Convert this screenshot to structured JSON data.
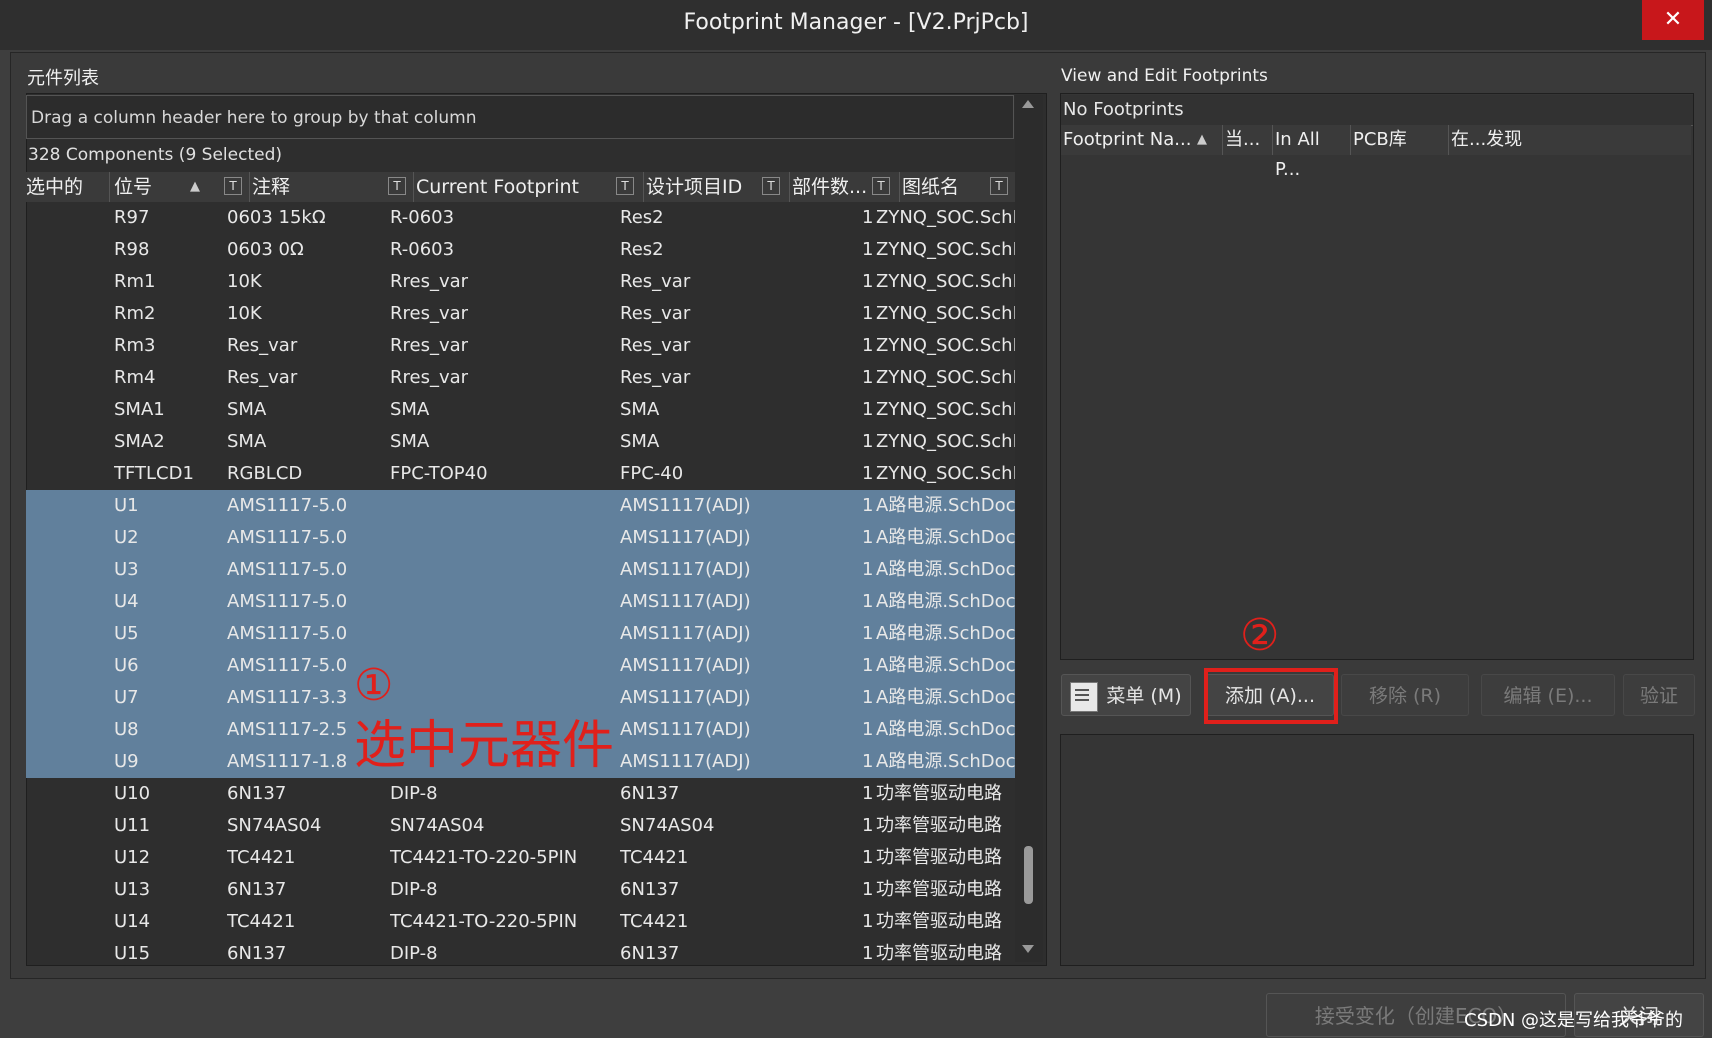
{
  "window": {
    "title": "Footprint Manager - [V2.PrjPcb]",
    "close_glyph": "✕"
  },
  "left": {
    "heading": "元件列表",
    "group_hint": "Drag a column header here to group by that column",
    "count": "328 Components (9 Selected)",
    "columns": [
      "选中的",
      "位号",
      "注释",
      "Current Footprint",
      "设计项目ID",
      "部件数...",
      "图纸名"
    ],
    "rows": [
      {
        "des": "R97",
        "comment": "0603 15kΩ",
        "fp": "R-0603",
        "id": "Res2",
        "parts": "1",
        "sheet": "ZYNQ_SOC.SchD",
        "sel": false
      },
      {
        "des": "R98",
        "comment": "0603 0Ω",
        "fp": "R-0603",
        "id": "Res2",
        "parts": "1",
        "sheet": "ZYNQ_SOC.SchD",
        "sel": false
      },
      {
        "des": "Rm1",
        "comment": "10K",
        "fp": "Rres_var",
        "id": "Res_var",
        "parts": "1",
        "sheet": "ZYNQ_SOC.SchD",
        "sel": false
      },
      {
        "des": "Rm2",
        "comment": "10K",
        "fp": "Rres_var",
        "id": "Res_var",
        "parts": "1",
        "sheet": "ZYNQ_SOC.SchD",
        "sel": false
      },
      {
        "des": "Rm3",
        "comment": "Res_var",
        "fp": "Rres_var",
        "id": "Res_var",
        "parts": "1",
        "sheet": "ZYNQ_SOC.SchD",
        "sel": false
      },
      {
        "des": "Rm4",
        "comment": "Res_var",
        "fp": "Rres_var",
        "id": "Res_var",
        "parts": "1",
        "sheet": "ZYNQ_SOC.SchD",
        "sel": false
      },
      {
        "des": "SMA1",
        "comment": "SMA",
        "fp": "SMA",
        "id": "SMA",
        "parts": "1",
        "sheet": "ZYNQ_SOC.SchD",
        "sel": false
      },
      {
        "des": "SMA2",
        "comment": "SMA",
        "fp": "SMA",
        "id": "SMA",
        "parts": "1",
        "sheet": "ZYNQ_SOC.SchD",
        "sel": false
      },
      {
        "des": "TFTLCD1",
        "comment": "RGBLCD",
        "fp": "FPC-TOP40",
        "id": "FPC-40",
        "parts": "1",
        "sheet": "ZYNQ_SOC.SchD",
        "sel": false
      },
      {
        "des": "U1",
        "comment": "AMS1117-5.0",
        "fp": "",
        "id": "AMS1117(ADJ)",
        "parts": "1",
        "sheet": "A路电源.SchDoc",
        "sel": true
      },
      {
        "des": "U2",
        "comment": "AMS1117-5.0",
        "fp": "",
        "id": "AMS1117(ADJ)",
        "parts": "1",
        "sheet": "A路电源.SchDoc",
        "sel": true
      },
      {
        "des": "U3",
        "comment": "AMS1117-5.0",
        "fp": "",
        "id": "AMS1117(ADJ)",
        "parts": "1",
        "sheet": "A路电源.SchDoc",
        "sel": true
      },
      {
        "des": "U4",
        "comment": "AMS1117-5.0",
        "fp": "",
        "id": "AMS1117(ADJ)",
        "parts": "1",
        "sheet": "A路电源.SchDoc",
        "sel": true
      },
      {
        "des": "U5",
        "comment": "AMS1117-5.0",
        "fp": "",
        "id": "AMS1117(ADJ)",
        "parts": "1",
        "sheet": "A路电源.SchDoc",
        "sel": true
      },
      {
        "des": "U6",
        "comment": "AMS1117-5.0",
        "fp": "",
        "id": "AMS1117(ADJ)",
        "parts": "1",
        "sheet": "A路电源.SchDoc",
        "sel": true
      },
      {
        "des": "U7",
        "comment": "AMS1117-3.3",
        "fp": "",
        "id": "AMS1117(ADJ)",
        "parts": "1",
        "sheet": "A路电源.SchDoc",
        "sel": true
      },
      {
        "des": "U8",
        "comment": "AMS1117-2.5",
        "fp": "",
        "id": "AMS1117(ADJ)",
        "parts": "1",
        "sheet": "A路电源.SchDoc",
        "sel": true
      },
      {
        "des": "U9",
        "comment": "AMS1117-1.8",
        "fp": "",
        "id": "AMS1117(ADJ)",
        "parts": "1",
        "sheet": "A路电源.SchDoc",
        "sel": true
      },
      {
        "des": "U10",
        "comment": "6N137",
        "fp": "DIP-8",
        "id": "6N137",
        "parts": "1",
        "sheet": "功率管驱动电路",
        "sel": false
      },
      {
        "des": "U11",
        "comment": "SN74AS04",
        "fp": "SN74AS04",
        "id": "SN74AS04",
        "parts": "1",
        "sheet": "功率管驱动电路",
        "sel": false
      },
      {
        "des": "U12",
        "comment": "TC4421",
        "fp": "TC4421-TO-220-5PIN",
        "id": "TC4421",
        "parts": "1",
        "sheet": "功率管驱动电路",
        "sel": false
      },
      {
        "des": "U13",
        "comment": "6N137",
        "fp": "DIP-8",
        "id": "6N137",
        "parts": "1",
        "sheet": "功率管驱动电路",
        "sel": false
      },
      {
        "des": "U14",
        "comment": "TC4421",
        "fp": "TC4421-TO-220-5PIN",
        "id": "TC4421",
        "parts": "1",
        "sheet": "功率管驱动电路",
        "sel": false
      },
      {
        "des": "U15",
        "comment": "6N137",
        "fp": "DIP-8",
        "id": "6N137",
        "parts": "1",
        "sheet": "功率管驱动电路",
        "sel": false
      }
    ],
    "selected_color": "#61809c"
  },
  "right": {
    "heading": "View and Edit Footprints",
    "no_footprints": "No Footprints",
    "columns": [
      "Footprint Na...",
      "当...",
      "In All P...",
      "PCB库",
      "在...发现"
    ],
    "buttons": {
      "menu": "菜单 (M)",
      "add": "添加 (A)...",
      "remove": "移除 (R)",
      "edit": "编辑 (E)...",
      "validate": "验证"
    }
  },
  "annotations": {
    "step1_num": "①",
    "step1_text": "选中元器件",
    "step2_num": "②",
    "color": "#e0201b"
  },
  "footer": {
    "accept": "接受变化（创建ECO）",
    "close": "关闭",
    "watermark": "CSDN @这是写给我爷爷的"
  },
  "icons": {
    "sort_up": "▲",
    "filter": "T",
    "scroll_up": "triangle-up",
    "scroll_down": "triangle-down"
  }
}
